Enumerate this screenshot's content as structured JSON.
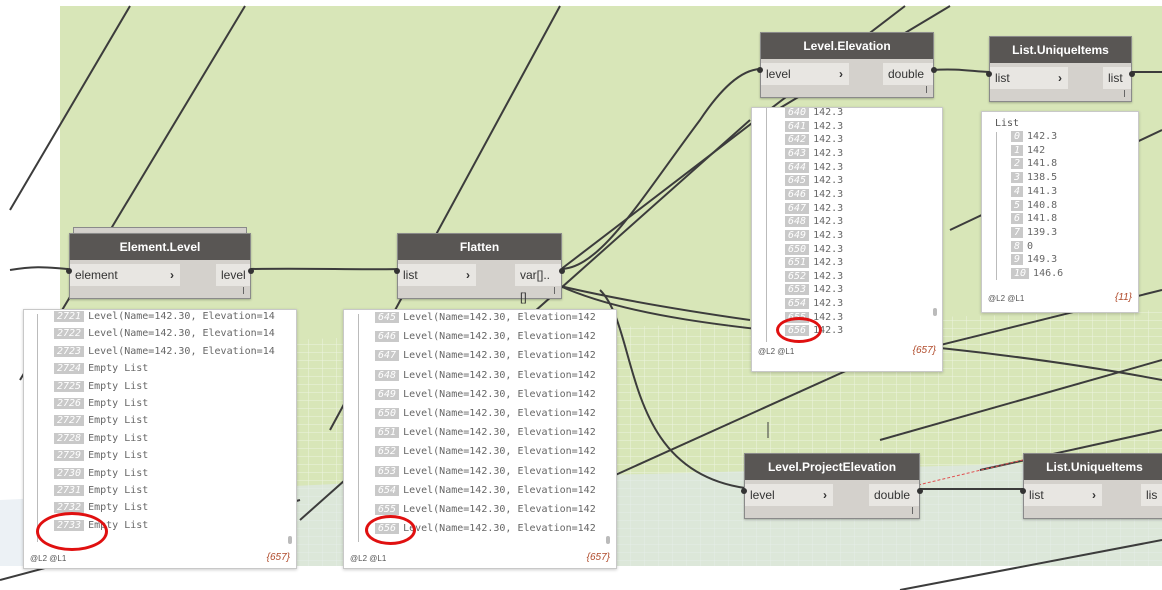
{
  "nodes": {
    "element_level": {
      "title": "Element.Level",
      "input": "element",
      "output": "level"
    },
    "flatten": {
      "title": "Flatten",
      "input": "list",
      "output": "var[]..[]"
    },
    "level_elevation": {
      "title": "Level.Elevation",
      "input": "level",
      "output": "double"
    },
    "unique_top": {
      "title": "List.UniqueItems",
      "input": "list",
      "output": "list"
    },
    "project_elevation": {
      "title": "Level.ProjectElevation",
      "input": "level",
      "output": "double"
    },
    "unique_bottom": {
      "title": "List.UniqueItems",
      "input": "list",
      "output": "lis"
    }
  },
  "previews": {
    "element_level": {
      "rows": [
        {
          "idx": "2721",
          "text": "Level(Name=142.30, Elevation=14"
        },
        {
          "idx": "2722",
          "text": "Level(Name=142.30, Elevation=14"
        },
        {
          "idx": "2723",
          "text": "Level(Name=142.30, Elevation=14"
        },
        {
          "idx": "2724",
          "text": "Empty List"
        },
        {
          "idx": "2725",
          "text": "Empty List"
        },
        {
          "idx": "2726",
          "text": "Empty List"
        },
        {
          "idx": "2727",
          "text": "Empty List"
        },
        {
          "idx": "2728",
          "text": "Empty List"
        },
        {
          "idx": "2729",
          "text": "Empty List"
        },
        {
          "idx": "2730",
          "text": "Empty List"
        },
        {
          "idx": "2731",
          "text": "Empty List"
        },
        {
          "idx": "2732",
          "text": "Empty List"
        },
        {
          "idx": "2733",
          "text": "Empty List"
        }
      ],
      "levels": "@L2 @L1",
      "count": "{657}"
    },
    "flatten": {
      "rows": [
        {
          "idx": "645",
          "text": "Level(Name=142.30, Elevation=142"
        },
        {
          "idx": "646",
          "text": "Level(Name=142.30, Elevation=142"
        },
        {
          "idx": "647",
          "text": "Level(Name=142.30, Elevation=142"
        },
        {
          "idx": "648",
          "text": "Level(Name=142.30, Elevation=142"
        },
        {
          "idx": "649",
          "text": "Level(Name=142.30, Elevation=142"
        },
        {
          "idx": "650",
          "text": "Level(Name=142.30, Elevation=142"
        },
        {
          "idx": "651",
          "text": "Level(Name=142.30, Elevation=142"
        },
        {
          "idx": "652",
          "text": "Level(Name=142.30, Elevation=142"
        },
        {
          "idx": "653",
          "text": "Level(Name=142.30, Elevation=142"
        },
        {
          "idx": "654",
          "text": "Level(Name=142.30, Elevation=142"
        },
        {
          "idx": "655",
          "text": "Level(Name=142.30, Elevation=142"
        },
        {
          "idx": "656",
          "text": "Level(Name=142.30, Elevation=142"
        }
      ],
      "levels": "@L2 @L1",
      "count": "{657}"
    },
    "level_elevation": {
      "rows": [
        {
          "idx": "640",
          "text": "142.3"
        },
        {
          "idx": "641",
          "text": "142.3"
        },
        {
          "idx": "642",
          "text": "142.3"
        },
        {
          "idx": "643",
          "text": "142.3"
        },
        {
          "idx": "644",
          "text": "142.3"
        },
        {
          "idx": "645",
          "text": "142.3"
        },
        {
          "idx": "646",
          "text": "142.3"
        },
        {
          "idx": "647",
          "text": "142.3"
        },
        {
          "idx": "648",
          "text": "142.3"
        },
        {
          "idx": "649",
          "text": "142.3"
        },
        {
          "idx": "650",
          "text": "142.3"
        },
        {
          "idx": "651",
          "text": "142.3"
        },
        {
          "idx": "652",
          "text": "142.3"
        },
        {
          "idx": "653",
          "text": "142.3"
        },
        {
          "idx": "654",
          "text": "142.3"
        },
        {
          "idx": "655",
          "text": "142.3"
        },
        {
          "idx": "656",
          "text": "142.3"
        }
      ],
      "levels": "@L2 @L1",
      "count": "{657}"
    },
    "unique_top": {
      "title": "List",
      "rows": [
        {
          "idx": "0",
          "text": "142.3"
        },
        {
          "idx": "1",
          "text": "142"
        },
        {
          "idx": "2",
          "text": "141.8"
        },
        {
          "idx": "3",
          "text": "138.5"
        },
        {
          "idx": "4",
          "text": "141.3"
        },
        {
          "idx": "5",
          "text": "140.8"
        },
        {
          "idx": "6",
          "text": "141.8"
        },
        {
          "idx": "7",
          "text": "139.3"
        },
        {
          "idx": "8",
          "text": "0"
        },
        {
          "idx": "9",
          "text": "149.3"
        },
        {
          "idx": "10",
          "text": "146.6"
        }
      ],
      "levels": "@L2 @L1",
      "count": "{11}"
    }
  },
  "colors": {
    "background_green": "#d8e6b8",
    "node_header": "#595654",
    "node_body": "#d4d1cc",
    "wire": "#3c3c3c",
    "highlight": "#e01010",
    "count_text": "#b04a2a"
  }
}
